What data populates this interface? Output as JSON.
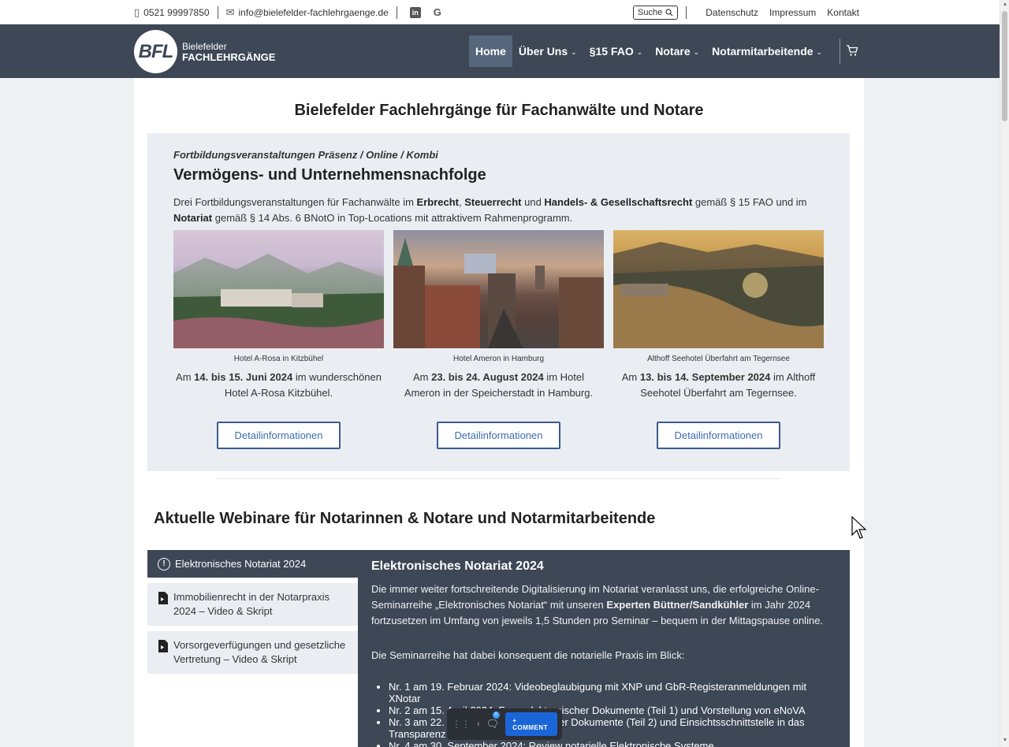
{
  "topbar": {
    "phone": "0521 99997850",
    "email": "info@bielefelder-fachlehrgaenge.de",
    "search_label": "Suche",
    "links": [
      "Datenschutz",
      "Impressum",
      "Kontakt"
    ]
  },
  "header": {
    "logo_mark": "BFL",
    "logo_line1": "Bielefelder",
    "logo_line2": "FACHLEHRGÄNGE",
    "nav": [
      {
        "label": "Home",
        "active": true,
        "dropdown": false
      },
      {
        "label": "Über Uns",
        "active": false,
        "dropdown": true
      },
      {
        "label": "§15 FAO",
        "active": false,
        "dropdown": true
      },
      {
        "label": "Notare",
        "active": false,
        "dropdown": true
      },
      {
        "label": "Notarmitarbeitende",
        "active": false,
        "dropdown": true
      }
    ]
  },
  "main": {
    "title": "Bielefelder Fachlehrgänge für Fachanwälte und Notare",
    "hero": {
      "kicker": "Fortbildungsveranstaltungen Präsenz / Online / Kombi",
      "title": "Vermögens- und Unternehmensnachfolge",
      "desc_parts": {
        "p1": "Drei Fortbildungsveranstaltungen für Fachanwälte im ",
        "b1": "Erbrecht",
        "p2": ", ",
        "b2": "Steuerrecht",
        "p3": " und ",
        "b3": "Handels- & Gesellschaftsrecht",
        "p4": " gemäß § 15 FAO und im ",
        "b4": "Notariat",
        "p5": " gemäß § 14 Abs. 6 BNotO in Top-Locations mit attraktivem Rahmenprogramm."
      },
      "cards": [
        {
          "caption": "Hotel A-Rosa in Kitzbühel",
          "pre": "Am ",
          "date": "14. bis 15. Juni 2024",
          "post": " im wunderschönen Hotel A-Rosa Kitzbühel.",
          "button": "Detailinformationen"
        },
        {
          "caption": "Hotel Ameron in Hamburg",
          "pre": "Am ",
          "date": "23. bis 24. August 2024",
          "post": " im Hotel Ameron in der Speicherstadt in Hamburg.",
          "button": "Detailinformationen"
        },
        {
          "caption": "Althoff Seehotel Überfahrt am Tegernsee",
          "pre": "Am ",
          "date": "13. bis 14. September 2024",
          "post": " im Althoff Seehotel Überfahrt am Tegernsee.",
          "button": "Detailinformationen"
        }
      ]
    },
    "webinars": {
      "title": "Aktuelle Webinare für Notarinnen & Notare und Notarmitarbeitende",
      "tabs": [
        {
          "label": "Elektronisches Notariat 2024",
          "active": true
        },
        {
          "label": "Immobilienrecht in der Notarpraxis 2024 – Video & Skript",
          "active": false
        },
        {
          "label": "Vorsorgeverfügungen und gesetzliche Vertretung – Video & Skript",
          "active": false
        }
      ],
      "panel": {
        "title": "Elektronisches Notariat 2024",
        "p1_a": "Die immer weiter fortschreitende Digitalisierung im Notariat veranlasst uns, die erfolgreiche Online-Seminarreihe „Elektronisches Notariat“ mit unseren ",
        "p1_b": "Experten Büttner/Sandkühler",
        "p1_c": " im Jahr 2024 fortzusetzen im Umfang von jeweils 1,5 Stunden pro Seminar – bequem in der Mittagspause online.",
        "p2": "Die Seminarreihe hat dabei konsequent die notarielle Praxis im Blick:",
        "items": [
          "Nr. 1 am 19. Februar 2024: Videobeglaubigung mit XNP und GbR-Registeranmeldungen mit XNotar",
          "Nr. 2 am 15. April 2024: Form elektronischer Dokumente (Teil 1) und Vorstellung von eNoVA",
          "Nr. 3 am 22. A",
          "Nr. 4 am 30. September 2024: Review notarielle Elektronische Systeme"
        ],
        "item3_tail": "cher Dokumente (Teil 2) und Einsichtsschnittstelle in das",
        "item3_line2": "Transparenz"
      }
    }
  },
  "comment_bar": {
    "badge": "0",
    "button": "+ COMMENT"
  },
  "colors": {
    "header_bg": "#3d4756",
    "active_nav": "#56677c",
    "button_border": "#3d5a8c",
    "button_text": "#3d6cb5",
    "hero_bg": "#eaeef3"
  }
}
